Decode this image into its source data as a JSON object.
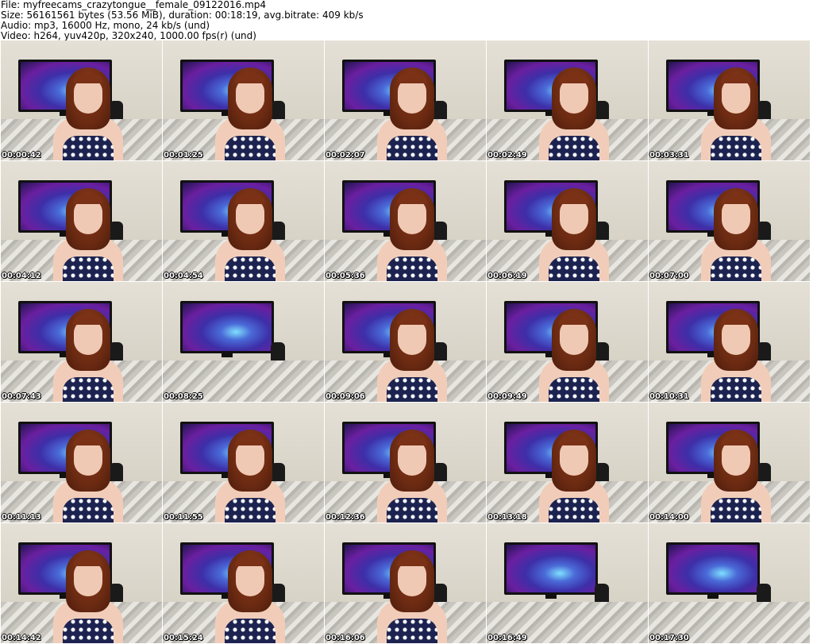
{
  "header": {
    "file_line": "File: myfreecams_crazytongue__female_09122016.mp4",
    "size_line": "Size: 56161561 bytes (53.56 MiB), duration: 00:18:19, avg.bitrate: 409 kb/s",
    "audio_line": "Audio: mp3, 16000 Hz, mono, 24 kb/s (und)",
    "video_line": "Video: h264, yuv420p, 320x240, 1000.00 fps(r) (und)"
  },
  "thumbnails": [
    {
      "time": "00:00:42"
    },
    {
      "time": "00:01:25"
    },
    {
      "time": "00:02:07"
    },
    {
      "time": "00:02:49"
    },
    {
      "time": "00:03:31"
    },
    {
      "time": "00:04:12"
    },
    {
      "time": "00:04:54"
    },
    {
      "time": "00:05:36"
    },
    {
      "time": "00:06:19"
    },
    {
      "time": "00:07:00"
    },
    {
      "time": "00:07:43"
    },
    {
      "time": "00:08:25"
    },
    {
      "time": "00:09:06"
    },
    {
      "time": "00:09:49"
    },
    {
      "time": "00:10:31"
    },
    {
      "time": "00:11:13"
    },
    {
      "time": "00:11:55"
    },
    {
      "time": "00:12:36"
    },
    {
      "time": "00:13:18"
    },
    {
      "time": "00:14:00"
    },
    {
      "time": "00:14:42"
    },
    {
      "time": "00:15:24"
    },
    {
      "time": "00:16:06"
    },
    {
      "time": "00:16:49"
    },
    {
      "time": "00:17:30"
    }
  ]
}
